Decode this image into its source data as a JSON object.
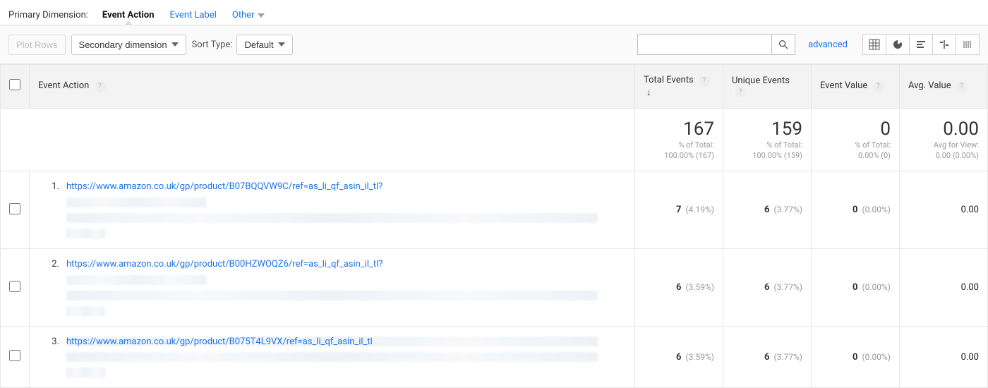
{
  "tabs": {
    "label": "Primary Dimension:",
    "items": [
      "Event Action",
      "Event Label",
      "Other"
    ],
    "active_index": 0
  },
  "toolbar": {
    "plot_rows": "Plot Rows",
    "secondary_dimension": "Secondary dimension",
    "sort_type_label": "Sort Type:",
    "sort_default": "Default",
    "search_placeholder": "",
    "advanced": "advanced"
  },
  "headers": {
    "event_action": "Event Action",
    "total_events": "Total Events",
    "unique_events": "Unique Events",
    "event_value": "Event Value",
    "avg_value": "Avg. Value"
  },
  "summary": {
    "total_events": {
      "value": "167",
      "sub1": "% of Total:",
      "sub2": "100.00% (167)"
    },
    "unique_events": {
      "value": "159",
      "sub1": "% of Total:",
      "sub2": "100.00% (159)"
    },
    "event_value": {
      "value": "0",
      "sub1": "% of Total:",
      "sub2": "0.00% (0)"
    },
    "avg_value": {
      "value": "0.00",
      "sub1": "Avg for View:",
      "sub2": "0.00 (0.00%)"
    }
  },
  "rows": [
    {
      "num": "1.",
      "url": "https://www.amazon.co.uk/gp/product/B07BQQVW9C/ref=as_li_qf_asin_il_tl?",
      "total_events": "7",
      "total_events_pct": "(4.19%)",
      "unique_events": "6",
      "unique_events_pct": "(3.77%)",
      "event_value": "0",
      "event_value_pct": "(0.00%)",
      "avg_value": "0.00"
    },
    {
      "num": "2.",
      "url": "https://www.amazon.co.uk/gp/product/B00HZWOQZ6/ref=as_li_qf_asin_il_tl?",
      "total_events": "6",
      "total_events_pct": "(3.59%)",
      "unique_events": "6",
      "unique_events_pct": "(3.77%)",
      "event_value": "0",
      "event_value_pct": "(0.00%)",
      "avg_value": "0.00"
    },
    {
      "num": "3.",
      "url": "https://www.amazon.co.uk/gp/product/B075T4L9VX/ref=as_li_qf_asin_il_tl",
      "total_events": "6",
      "total_events_pct": "(3.59%)",
      "unique_events": "6",
      "unique_events_pct": "(3.77%)",
      "event_value": "0",
      "event_value_pct": "(0.00%)",
      "avg_value": "0.00"
    }
  ],
  "chart_data": {
    "type": "table",
    "title": "Events by Event Action",
    "columns": [
      "Event Action",
      "Total Events",
      "Unique Events",
      "Event Value",
      "Avg. Value"
    ],
    "totals": {
      "total_events": 167,
      "unique_events": 159,
      "event_value": 0,
      "avg_value": 0.0
    },
    "rows": [
      {
        "action": "https://www.amazon.co.uk/gp/product/B07BQQVW9C/ref=as_li_qf_asin_il_tl?",
        "total_events": 7,
        "total_events_pct": 4.19,
        "unique_events": 6,
        "unique_events_pct": 3.77,
        "event_value": 0,
        "event_value_pct": 0.0,
        "avg_value": 0.0
      },
      {
        "action": "https://www.amazon.co.uk/gp/product/B00HZWOQZ6/ref=as_li_qf_asin_il_tl?",
        "total_events": 6,
        "total_events_pct": 3.59,
        "unique_events": 6,
        "unique_events_pct": 3.77,
        "event_value": 0,
        "event_value_pct": 0.0,
        "avg_value": 0.0
      },
      {
        "action": "https://www.amazon.co.uk/gp/product/B075T4L9VX/ref=as_li_qf_asin_il_tl",
        "total_events": 6,
        "total_events_pct": 3.59,
        "unique_events": 6,
        "unique_events_pct": 3.77,
        "event_value": 0,
        "event_value_pct": 0.0,
        "avg_value": 0.0
      }
    ]
  }
}
